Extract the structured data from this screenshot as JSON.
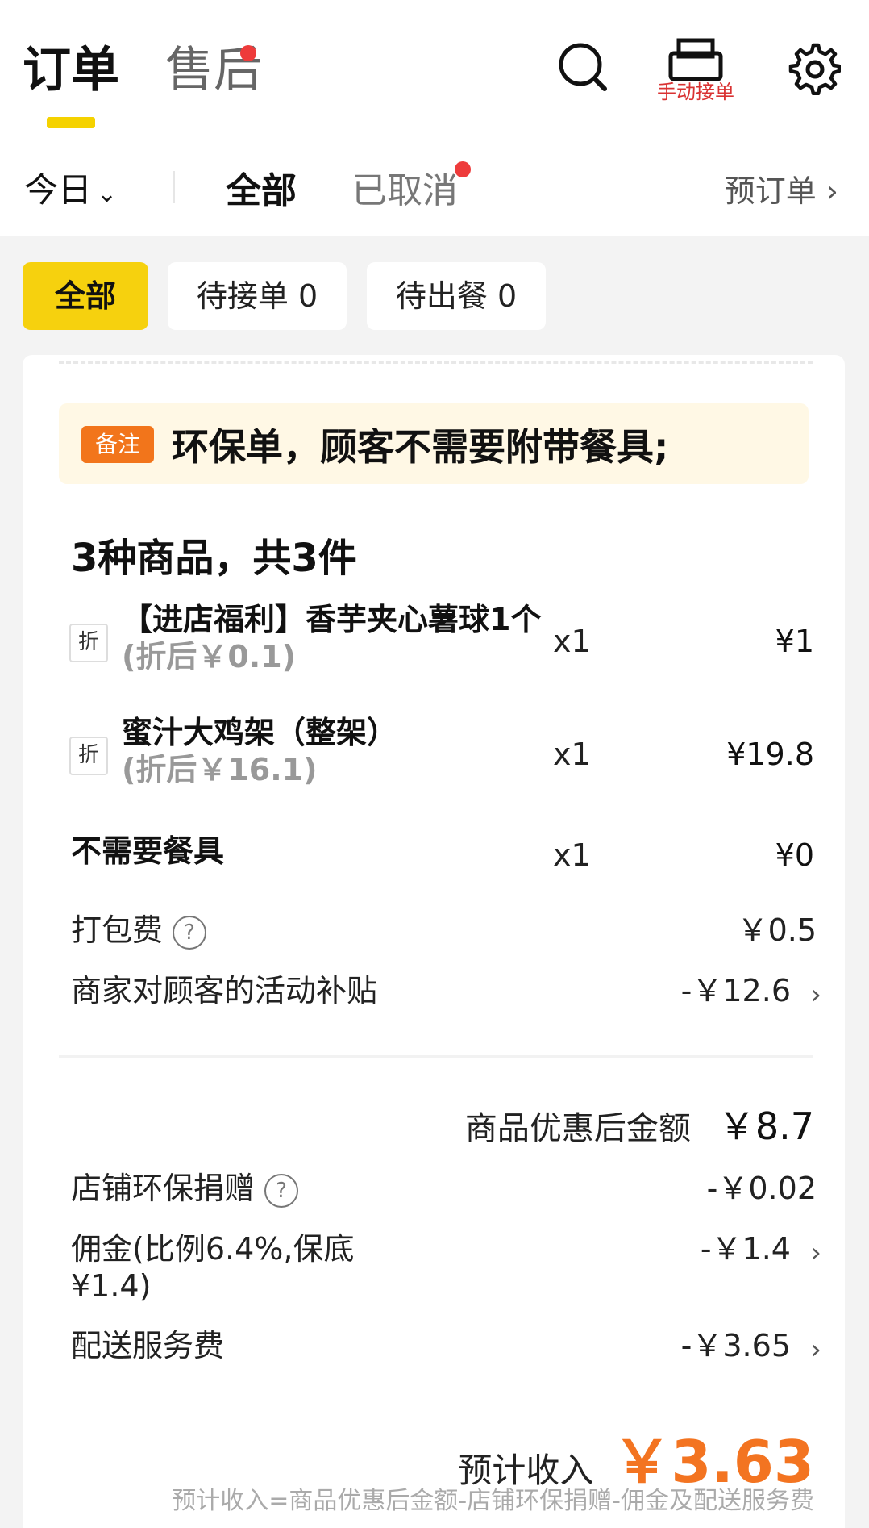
{
  "header": {
    "tab_orders": "订单",
    "tab_after_sales": "售后",
    "print_label": "手动接单"
  },
  "subnav": {
    "date_filter": "今日",
    "tab_all": "全部",
    "tab_cancelled": "已取消",
    "preorder": "预订单"
  },
  "filters": {
    "all": "全部",
    "pending_accept": "待接单 0",
    "pending_prepare": "待出餐 0"
  },
  "order": {
    "note_badge": "备注",
    "note_text": "环保单，顾客不需要附带餐具;",
    "goods_summary": "3种商品，共3件",
    "discount_tag": "折",
    "items": [
      {
        "name": "【进店福利】香芋夹心薯球1个",
        "after_discount": "(折后￥0.1)",
        "qty": "x1",
        "price": "¥1"
      },
      {
        "name": "蜜汁大鸡架（整架）",
        "after_discount": "(折后￥16.1)",
        "qty": "x1",
        "price": "¥19.8"
      },
      {
        "name": "不需要餐具",
        "qty": "x1",
        "price": "¥0"
      }
    ],
    "packing_fee_label": "打包费",
    "packing_fee": "￥0.5",
    "merchant_subsidy_label": "商家对顾客的活动补贴",
    "merchant_subsidy": "-￥12.6",
    "subtotal_label": "商品优惠后金额",
    "subtotal": "￥8.7",
    "eco_donation_label": "店铺环保捐赠",
    "eco_donation": "-￥0.02",
    "commission_label": "佣金(比例6.4%,保底¥1.4)",
    "commission": "-￥1.4",
    "delivery_fee_label": "配送服务费",
    "delivery_fee": "-￥3.65",
    "income_label": "预计收入",
    "income": "￥3.63",
    "formula": "预计收入=商品优惠后金额-店铺环保捐赠-佣金及配送服务费"
  },
  "colors": {
    "accent_yellow": "#f6d10e",
    "badge_orange": "#f2751b",
    "income_orange": "#f37421",
    "dot_red": "#ee3b3b"
  }
}
